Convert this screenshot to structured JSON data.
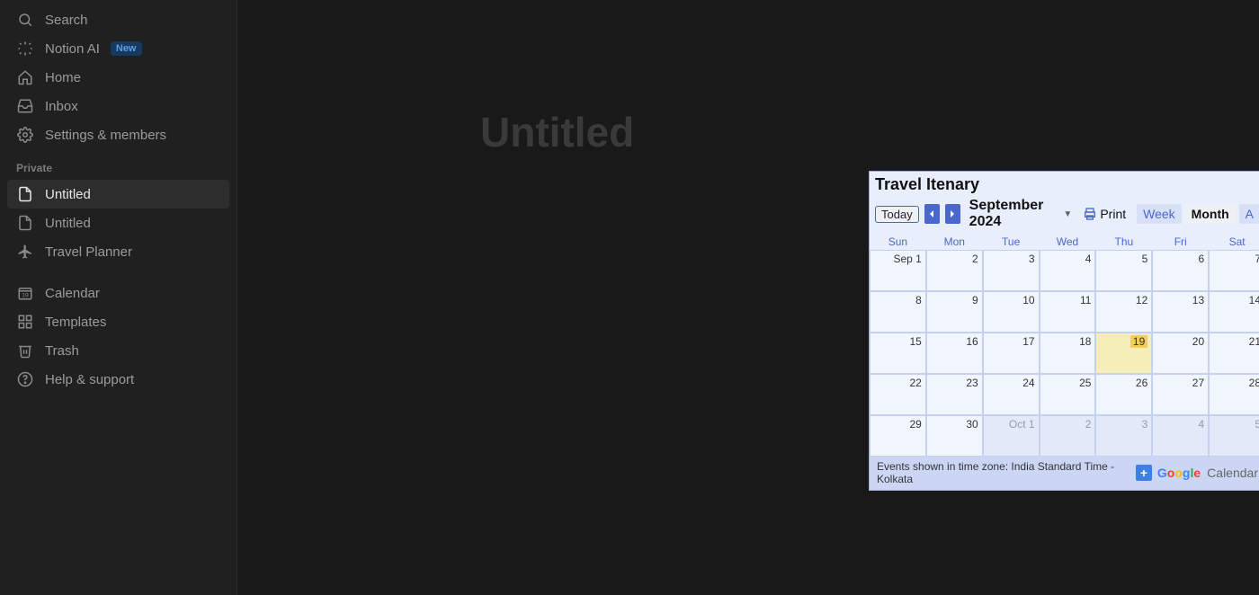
{
  "sidebar": {
    "search": "Search",
    "notion_ai": "Notion AI",
    "notion_ai_badge": "New",
    "home": "Home",
    "inbox": "Inbox",
    "settings": "Settings & members",
    "private_label": "Private",
    "pages": [
      {
        "label": "Untitled",
        "active": true
      },
      {
        "label": "Untitled",
        "active": false
      },
      {
        "label": "Travel Planner",
        "active": false
      }
    ],
    "calendar": "Calendar",
    "templates": "Templates",
    "trash": "Trash",
    "help": "Help & support"
  },
  "page": {
    "title": "Untitled"
  },
  "calendar_embed": {
    "title": "Travel Itenary",
    "today_btn": "Today",
    "month_label": "September 2024",
    "print_label": "Print",
    "views": {
      "week": "Week",
      "month": "Month",
      "agenda_partial": "A"
    },
    "active_view": "Month",
    "dow": [
      "Sun",
      "Mon",
      "Tue",
      "Wed",
      "Thu",
      "Fri",
      "Sat"
    ],
    "weeks": [
      [
        {
          "n": "Sep 1"
        },
        {
          "n": "2"
        },
        {
          "n": "3"
        },
        {
          "n": "4"
        },
        {
          "n": "5"
        },
        {
          "n": "6"
        },
        {
          "n": "7"
        }
      ],
      [
        {
          "n": "8"
        },
        {
          "n": "9"
        },
        {
          "n": "10"
        },
        {
          "n": "11"
        },
        {
          "n": "12"
        },
        {
          "n": "13"
        },
        {
          "n": "14"
        }
      ],
      [
        {
          "n": "15"
        },
        {
          "n": "16"
        },
        {
          "n": "17"
        },
        {
          "n": "18"
        },
        {
          "n": "19",
          "today": true
        },
        {
          "n": "20"
        },
        {
          "n": "21"
        }
      ],
      [
        {
          "n": "22"
        },
        {
          "n": "23"
        },
        {
          "n": "24"
        },
        {
          "n": "25"
        },
        {
          "n": "26"
        },
        {
          "n": "27"
        },
        {
          "n": "28"
        }
      ],
      [
        {
          "n": "29"
        },
        {
          "n": "30"
        },
        {
          "n": "Oct 1",
          "out": true
        },
        {
          "n": "2",
          "out": true
        },
        {
          "n": "3",
          "out": true
        },
        {
          "n": "4",
          "out": true
        },
        {
          "n": "5",
          "out": true
        }
      ]
    ],
    "footer_tz": "Events shown in time zone: India Standard Time - Kolkata",
    "footer_brand": "Calendar"
  }
}
